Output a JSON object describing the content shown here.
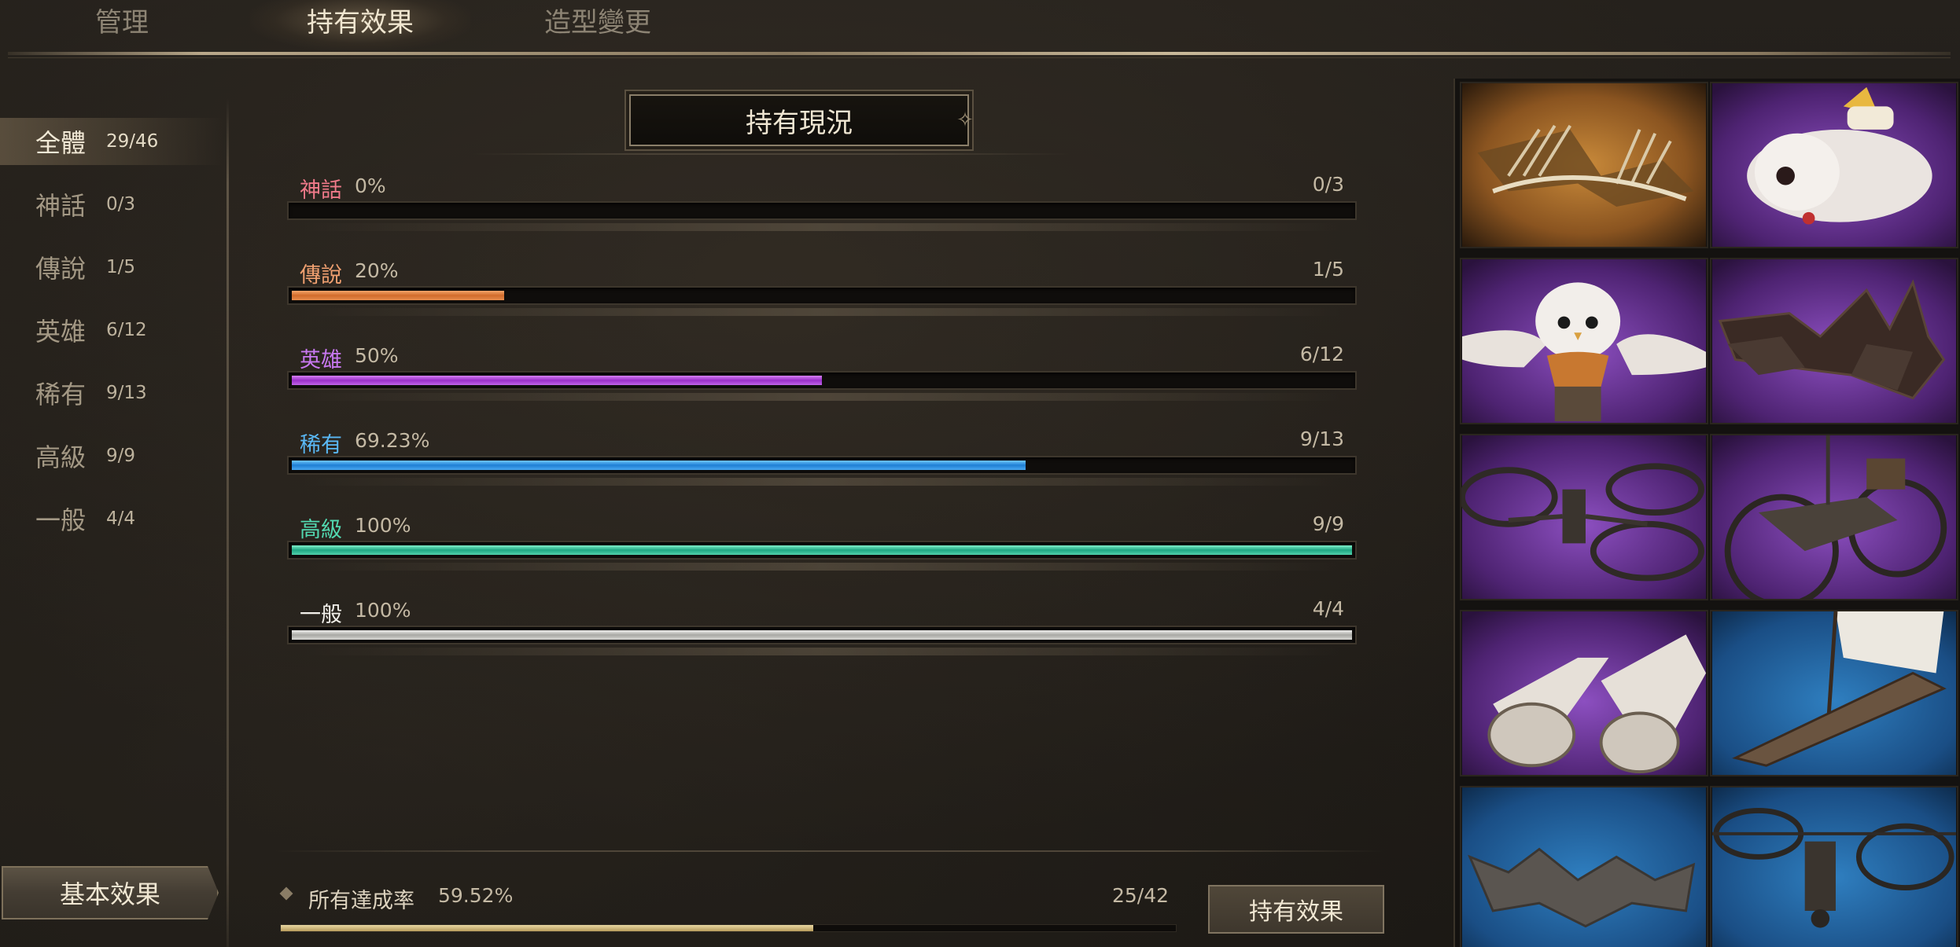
{
  "tabs": [
    {
      "label": "管理",
      "active": false
    },
    {
      "label": "持有效果",
      "active": true
    },
    {
      "label": "造型變更",
      "active": false
    }
  ],
  "sidebar": {
    "items": [
      {
        "name": "全體",
        "count": "29/46",
        "active": true
      },
      {
        "name": "神話",
        "count": "0/3",
        "active": false
      },
      {
        "name": "傳說",
        "count": "1/5",
        "active": false
      },
      {
        "name": "英雄",
        "count": "6/12",
        "active": false
      },
      {
        "name": "稀有",
        "count": "9/13",
        "active": false
      },
      {
        "name": "高級",
        "count": "9/9",
        "active": false
      },
      {
        "name": "一般",
        "count": "4/4",
        "active": false
      }
    ],
    "basic_effect_label": "基本效果"
  },
  "main": {
    "title": "持有現況",
    "rows": [
      {
        "name": "神話",
        "pct": "0%",
        "count": "0/3",
        "fill": 0,
        "color": "#f07a8a"
      },
      {
        "name": "傳說",
        "pct": "20%",
        "count": "1/5",
        "fill": 0.2,
        "color": "#f0a070"
      },
      {
        "name": "英雄",
        "pct": "50%",
        "count": "6/12",
        "fill": 0.5,
        "color": "#c878f0"
      },
      {
        "name": "稀有",
        "pct": "69.23%",
        "count": "9/13",
        "fill": 0.6923,
        "color": "#5ab8f5"
      },
      {
        "name": "高級",
        "pct": "100%",
        "count": "9/9",
        "fill": 1.0,
        "color": "#52d8b0"
      },
      {
        "name": "一般",
        "pct": "100%",
        "count": "4/4",
        "fill": 1.0,
        "color": "#f2f0ea"
      }
    ],
    "total": {
      "label": "所有達成率",
      "pct": "59.52%",
      "count": "25/42",
      "fill": 0.5952
    },
    "effect_button_label": "持有效果"
  },
  "grid": {
    "items": [
      {
        "icon": "golden-wings-icon",
        "bg": "gold"
      },
      {
        "icon": "white-cat-mount-icon",
        "bg": "purple"
      },
      {
        "icon": "owl-pet-icon",
        "bg": "purple"
      },
      {
        "icon": "dark-wings-icon",
        "bg": "purple"
      },
      {
        "icon": "gyrocopter-icon",
        "bg": "purple"
      },
      {
        "icon": "gyro-vehicle-icon",
        "bg": "purple"
      },
      {
        "icon": "balloon-airship-icon",
        "bg": "purple"
      },
      {
        "icon": "sail-boat-icon",
        "bg": "blue"
      },
      {
        "icon": "bat-wings-icon",
        "bg": "blue"
      },
      {
        "icon": "rotor-glider-icon",
        "bg": "blue"
      }
    ]
  }
}
